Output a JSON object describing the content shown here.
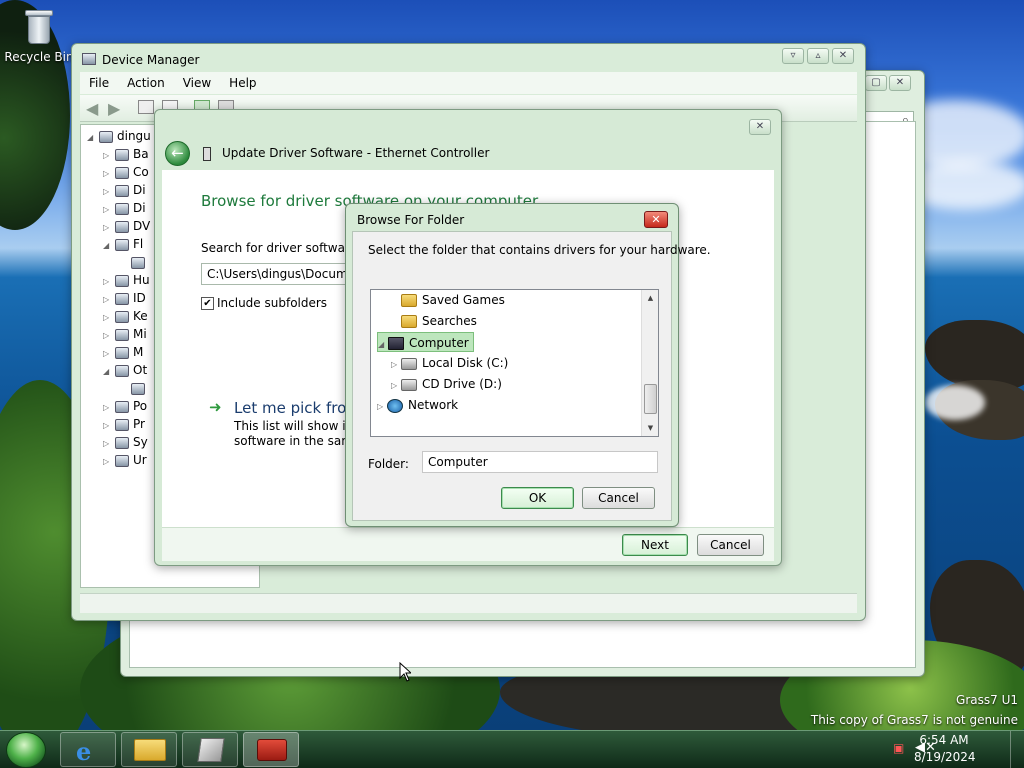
{
  "desktop": {
    "recycle_bin_label": "Recycle Bin",
    "watermark_line1": "Grass7 U1",
    "watermark_line2": "This copy of Grass7 is not genuine"
  },
  "device_manager": {
    "title": "Device Manager",
    "menu": [
      "File",
      "Action",
      "View",
      "Help"
    ],
    "tree": [
      {
        "label": "dingu",
        "arrow": "◢",
        "indent": 0
      },
      {
        "label": "Ba",
        "arrow": "▷",
        "indent": 1
      },
      {
        "label": "Co",
        "arrow": "▷",
        "indent": 1
      },
      {
        "label": "Di",
        "arrow": "▷",
        "indent": 1
      },
      {
        "label": "Di",
        "arrow": "▷",
        "indent": 1
      },
      {
        "label": "DV",
        "arrow": "▷",
        "indent": 1
      },
      {
        "label": "Fl",
        "arrow": "◢",
        "indent": 1
      },
      {
        "label": "",
        "arrow": "",
        "indent": 2
      },
      {
        "label": "Hu",
        "arrow": "▷",
        "indent": 1
      },
      {
        "label": "ID",
        "arrow": "▷",
        "indent": 1
      },
      {
        "label": "Ke",
        "arrow": "▷",
        "indent": 1
      },
      {
        "label": "Mi",
        "arrow": "▷",
        "indent": 1
      },
      {
        "label": "M",
        "arrow": "▷",
        "indent": 1
      },
      {
        "label": "Ot",
        "arrow": "◢",
        "indent": 1
      },
      {
        "label": "",
        "arrow": "",
        "indent": 2
      },
      {
        "label": "Po",
        "arrow": "▷",
        "indent": 1
      },
      {
        "label": "Pr",
        "arrow": "▷",
        "indent": 1
      },
      {
        "label": "Sy",
        "arrow": "▷",
        "indent": 1
      },
      {
        "label": "Ur",
        "arrow": "▷",
        "indent": 1
      }
    ]
  },
  "wizard": {
    "title": "Update Driver Software - Ethernet Controller",
    "heading": "Browse for driver software on your computer",
    "search_label": "Search for driver software in",
    "path_value": "C:\\Users\\dingus\\Documen",
    "include_subfolders": "Include subfolders",
    "pick_title": "Let me pick from",
    "pick_desc_line1": "This list will show inst",
    "pick_desc_line2": "software in the same",
    "next_label": "Next",
    "cancel_label": "Cancel"
  },
  "browse_dialog": {
    "title": "Browse For Folder",
    "instruction": "Select the folder that contains drivers for your hardware.",
    "tree": [
      {
        "label": "Saved Games",
        "icon": "folder-icon",
        "arrow": "",
        "level": 1,
        "selected": false
      },
      {
        "label": "Searches",
        "icon": "folder-icon",
        "arrow": "",
        "level": 1,
        "selected": false
      },
      {
        "label": "Computer",
        "icon": "computer-icon",
        "arrow": "◢",
        "level": 0,
        "selected": true
      },
      {
        "label": "Local Disk (C:)",
        "icon": "hard-disk-icon",
        "arrow": "▷",
        "level": 1,
        "selected": false
      },
      {
        "label": "CD Drive (D:)",
        "icon": "cd-drive-icon",
        "arrow": "▷",
        "level": 1,
        "selected": false
      },
      {
        "label": "Network",
        "icon": "network-icon",
        "arrow": "▷",
        "level": 0,
        "selected": false
      }
    ],
    "folder_label": "Folder:",
    "folder_value": "Computer",
    "ok_label": "OK",
    "cancel_label": "Cancel"
  },
  "taskbar": {
    "time": "6:54 AM",
    "date": "8/19/2024",
    "pinned": [
      "internet-explorer-icon",
      "file-explorer-icon",
      "setup-icon",
      "device-manager-toolbox-icon"
    ]
  }
}
